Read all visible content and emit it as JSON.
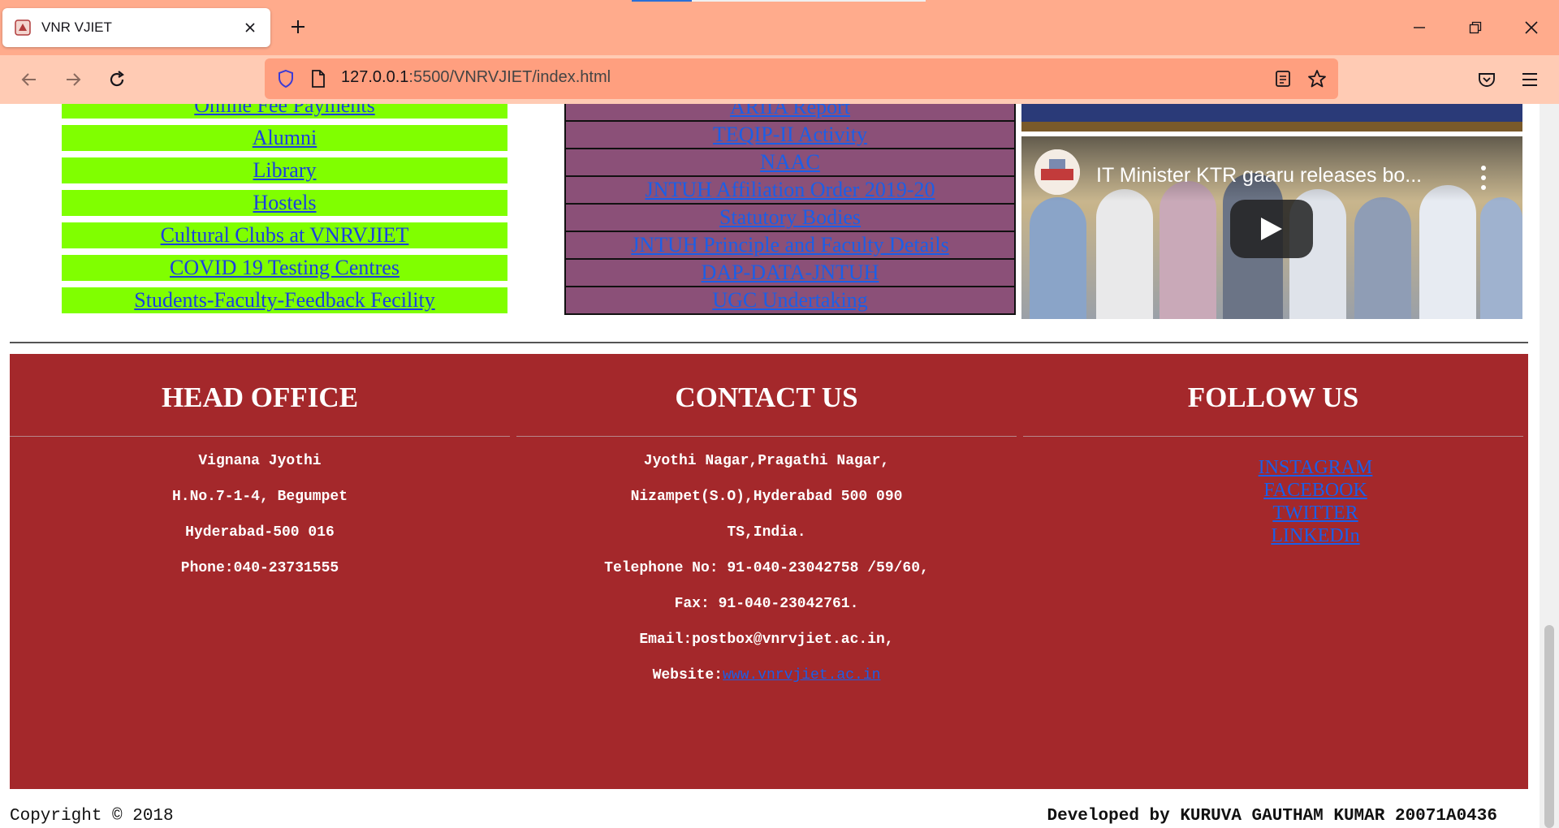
{
  "browser": {
    "tab_title": "VNR VJIET",
    "url_host": "127.0.0.1",
    "url_rest": ":5500/VNRVJIET/index.html",
    "icons": [
      "vnrvjiet-favicon-icon",
      "close-icon",
      "plus-icon",
      "minimize-icon",
      "restore-icon",
      "close-window-icon",
      "back-arrow-icon",
      "forward-arrow-icon",
      "reload-icon",
      "shield-icon",
      "page-icon",
      "reader-view-icon",
      "star-icon",
      "pocket-icon",
      "hamburger-menu-icon"
    ]
  },
  "quick_links": [
    "Online Fee Payments",
    "Alumni",
    "Library",
    "Hostels",
    "Cultural Clubs at VNRVJIET",
    "COVID 19 Testing Centres",
    "Students-Faculty-Feedback Fecility"
  ],
  "info_links": [
    "ARIIA Report",
    "TEQIP-II Activity",
    "NAAC",
    "JNTUH Affiliation Order 2019-20",
    "Statutory Bodies",
    "JNTUH Principle and Faculty Details",
    "DAP-DATA-JNTUH",
    "UGC Undertaking"
  ],
  "video": {
    "title": "IT Minister KTR gaaru releases bo..."
  },
  "footer": {
    "head_office": {
      "heading": "HEAD OFFICE",
      "lines": [
        "Vignana Jyothi",
        "H.No.7-1-4, Begumpet",
        "Hyderabad-500 016",
        "Phone:040-23731555"
      ]
    },
    "contact": {
      "heading": "CONTACT US",
      "lines": [
        "Jyothi Nagar,Pragathi Nagar,",
        "Nizampet(S.O),Hyderabad 500 090",
        "TS,India.",
        "Telephone No: 91-040-23042758 /59/60,",
        "Fax: 91-040-23042761.",
        "Email:postbox@vnrvjiet.ac.in,"
      ],
      "website_label": "Website:",
      "website_link": "www.vnrvjiet.ac.in"
    },
    "follow": {
      "heading": "FOLLOW US",
      "links": [
        "INSTAGRAM",
        "FACEBOOK",
        "TWITTER",
        "LINKEDIn"
      ]
    }
  },
  "bottom": {
    "copyright": "Copyright © 2018",
    "developer": "Developed by KURUVA GAUTHAM KUMAR 20071A0436"
  },
  "colors": {
    "titlebar": "#ffab8c",
    "navbar": "#ffcbb4",
    "green_links_bg": "#80ff00",
    "purple_links_bg": "#8b5078",
    "footer_bg": "#a4282b",
    "link": "#1a3fe0"
  }
}
